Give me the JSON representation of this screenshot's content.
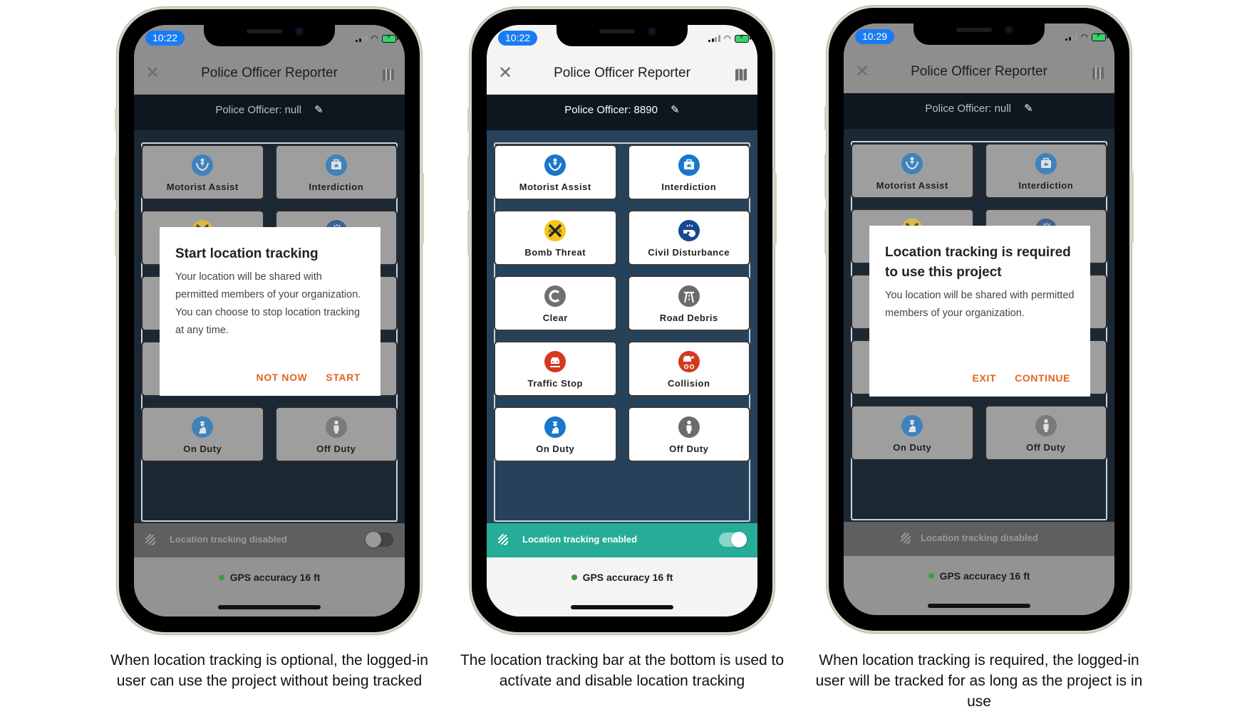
{
  "app": {
    "title": "Police Officer Reporter",
    "gps_text": "GPS accuracy 16 ft",
    "colors": {
      "accent_orange": "#e0661f",
      "tracking_enabled_bg": "#25ad98",
      "time_pill": "#1a7cf5",
      "gps_dot": "#3c9c46",
      "content_bg": "#26425a"
    }
  },
  "tiles": [
    {
      "label": "Motorist Assist",
      "icon": "motorist-assist-icon",
      "color": "#1877c9"
    },
    {
      "label": "Interdiction",
      "icon": "interdiction-icon",
      "color": "#1877c9"
    },
    {
      "label": "Bomb Threat",
      "icon": "railroad-crossing-icon",
      "color": "#f5c518"
    },
    {
      "label": "Civil Disturbance",
      "icon": "whistle-icon",
      "color": "#17488f"
    },
    {
      "label": "Clear",
      "icon": "clear-c-icon",
      "color": "#707070"
    },
    {
      "label": "Road Debris",
      "icon": "highway-icon",
      "color": "#6b6b6b"
    },
    {
      "label": "Traffic Stop",
      "icon": "traffic-stop-icon",
      "color": "#d23a1e"
    },
    {
      "label": "Collision",
      "icon": "collision-icon",
      "color": "#d23a1e"
    },
    {
      "label": "On Duty",
      "icon": "on-duty-officer-icon",
      "color": "#1877c9"
    },
    {
      "label": "Off Duty",
      "icon": "off-duty-person-icon",
      "color": "#6b6b6b"
    }
  ],
  "phones": [
    {
      "time": "10:22",
      "officer_label": "Police Officer: null",
      "tracking_label": "Location tracking disabled",
      "tracking_on": false,
      "dialog": {
        "title": "Start location tracking",
        "body": "Your location will be shared with permitted members of your organization. You can choose to stop location tracking at any time.",
        "secondary": "NOT NOW",
        "primary": "START"
      },
      "caption": "When location tracking is optional, the logged-in user can use the project without being tracked"
    },
    {
      "time": "10:22",
      "officer_label": "Police Officer: 8890",
      "tracking_label": "Location tracking enabled",
      "tracking_on": true,
      "caption": "The location tracking bar at the bottom is used to actívate and disable location tracking"
    },
    {
      "time": "10:29",
      "officer_label": "Police Officer: null",
      "tracking_label": "Location tracking disabled",
      "tracking_on": false,
      "dialog": {
        "title": "Location tracking is required to use this project",
        "body": "You location will be shared with permitted members of your organization.",
        "secondary": "EXIT",
        "primary": "CONTINUE"
      },
      "caption": "When location tracking is required, the logged-in user will be tracked for as long as the project is in use"
    }
  ]
}
